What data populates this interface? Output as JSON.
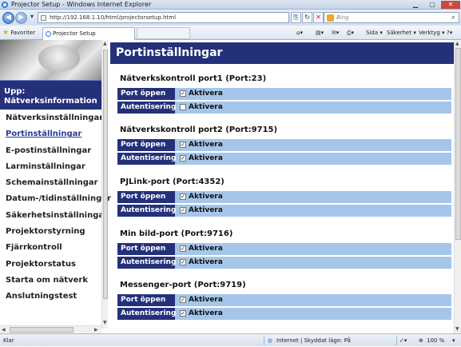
{
  "window": {
    "title": "Projector Setup - Windows Internet Explorer"
  },
  "toolbar": {
    "url": "http://192.168.1.10/html/projectorsetup.html",
    "search_placeholder": "Bing"
  },
  "favorites_bar": {
    "favorites_label": "Favoriter",
    "tab_label": "Projector Setup",
    "commands": [
      "Sida",
      "Säkerhet",
      "Verktyg"
    ]
  },
  "sidebar": {
    "upp_label": "Upp: Nätverksinformation",
    "items": [
      {
        "label": "Nätverksinställningar",
        "active": false
      },
      {
        "label": "Portinställningar",
        "active": true
      },
      {
        "label": "E-postinställningar",
        "active": false
      },
      {
        "label": "Larminställningar",
        "active": false
      },
      {
        "label": "Schemainställningar",
        "active": false
      },
      {
        "label": "Datum-/tidinställningar",
        "active": false
      },
      {
        "label": "Säkerhetsinställningar",
        "active": false
      },
      {
        "label": "Projektorstyrning",
        "active": false
      },
      {
        "label": "Fjärrkontroll",
        "active": false
      },
      {
        "label": "Projektorstatus",
        "active": false
      },
      {
        "label": "Starta om nätverk",
        "active": false
      },
      {
        "label": "Anslutningstest",
        "active": false
      }
    ]
  },
  "main": {
    "page_title": "Portinställningar",
    "sections": [
      {
        "title": "Nätverkskontroll port1 (Port:23)",
        "rows": [
          {
            "label": "Port öppen",
            "checkbox": "Aktivera",
            "checked": true
          },
          {
            "label": "Autentisering",
            "checkbox": "Aktivera",
            "checked": false
          }
        ]
      },
      {
        "title": "Nätverkskontroll port2 (Port:9715)",
        "rows": [
          {
            "label": "Port öppen",
            "checkbox": "Aktivera",
            "checked": true
          },
          {
            "label": "Autentisering",
            "checkbox": "Aktivera",
            "checked": true
          }
        ]
      },
      {
        "title": "PJLink-port (Port:4352)",
        "rows": [
          {
            "label": "Port öppen",
            "checkbox": "Aktivera",
            "checked": true
          },
          {
            "label": "Autentisering",
            "checkbox": "Aktivera",
            "checked": true
          }
        ]
      },
      {
        "title": "Min bild-port (Port:9716)",
        "rows": [
          {
            "label": "Port öppen",
            "checkbox": "Aktivera",
            "checked": true
          },
          {
            "label": "Autentisering",
            "checkbox": "Aktivera",
            "checked": true
          }
        ]
      },
      {
        "title": "Messenger-port (Port:9719)",
        "rows": [
          {
            "label": "Port öppen",
            "checkbox": "Aktivera",
            "checked": true
          },
          {
            "label": "Autentisering",
            "checkbox": "Aktivera",
            "checked": true
          }
        ]
      }
    ]
  },
  "statusbar": {
    "left": "Klar",
    "zone": "Internet | Skyddat läge: På",
    "zoom": "100 %"
  }
}
